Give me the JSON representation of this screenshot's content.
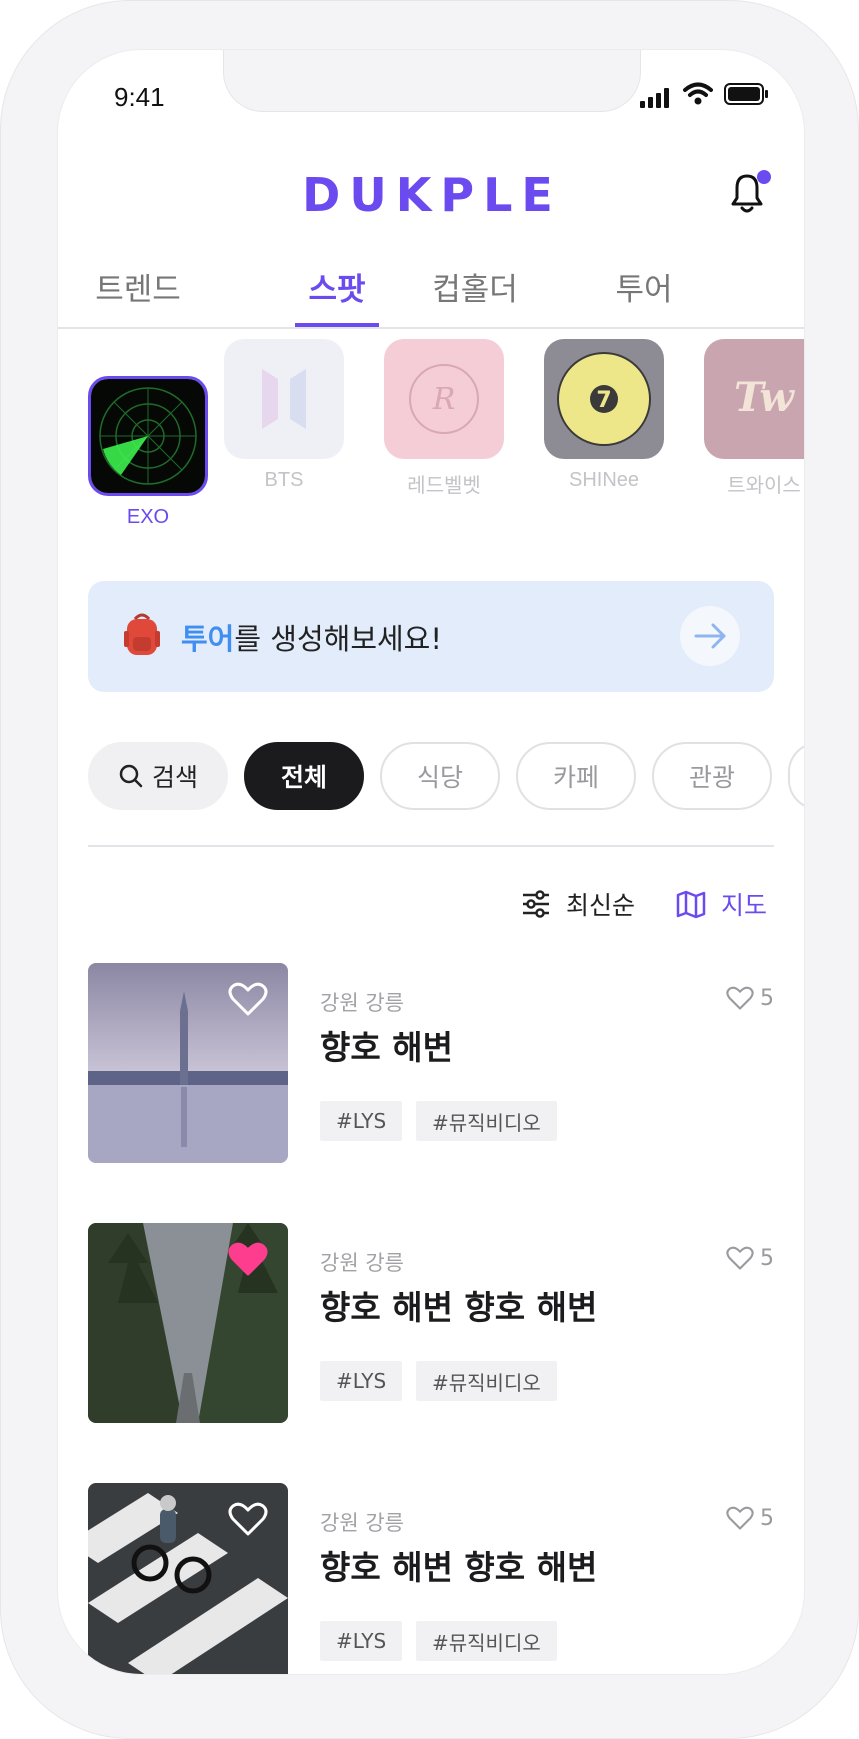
{
  "status_bar": {
    "time": "9:41"
  },
  "header": {
    "logo": "DUKPLE"
  },
  "tabs": [
    {
      "label": "트렌드",
      "active": false
    },
    {
      "label": "스팟",
      "active": true
    },
    {
      "label": "컵홀더",
      "active": false
    },
    {
      "label": "투어",
      "active": false
    }
  ],
  "artists": [
    {
      "name": "EXO",
      "selected": true
    },
    {
      "name": "BTS",
      "selected": false
    },
    {
      "name": "레드벨벳",
      "selected": false
    },
    {
      "name": "SHINee",
      "selected": false
    },
    {
      "name": "트와이스",
      "selected": false
    }
  ],
  "banner": {
    "highlight": "투어",
    "text": "를 생성해보세요!",
    "icon": "backpack-icon"
  },
  "filters": {
    "search_label": "검색",
    "categories": [
      "전체",
      "식당",
      "카페",
      "관광"
    ],
    "active": "전체"
  },
  "sort": {
    "label": "최신순"
  },
  "map": {
    "label": "지도"
  },
  "colors": {
    "accent": "#6b4bf0",
    "banner_bg": "#e2ecfb",
    "banner_highlight": "#3f8ef0",
    "liked": "#ff3d8e"
  },
  "spots": [
    {
      "region": "강원 강릉",
      "title": "향호 해변",
      "likes": "5",
      "liked": false,
      "tags": [
        "#LYS",
        "#뮤직비디오"
      ]
    },
    {
      "region": "강원 강릉",
      "title": "향호 해변 향호 해변",
      "likes": "5",
      "liked": true,
      "tags": [
        "#LYS",
        "#뮤직비디오"
      ]
    },
    {
      "region": "강원 강릉",
      "title": "향호 해변 향호 해변",
      "likes": "5",
      "liked": false,
      "tags": [
        "#LYS",
        "#뮤직비디오"
      ]
    }
  ]
}
